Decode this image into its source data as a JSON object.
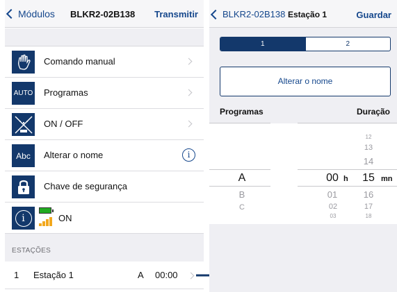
{
  "left": {
    "nav": {
      "back_label": "Módulos",
      "title": "BLKR2-02B138",
      "action_label": "Transmitir"
    },
    "menu": [
      {
        "icon": "hand-icon",
        "label": "Comando manual"
      },
      {
        "icon_text": "AUTO",
        "label": "Programas"
      },
      {
        "icon": "sprinkler-off-icon",
        "label": "ON / OFF"
      },
      {
        "icon_text": "Abc",
        "label": "Alterar o nome",
        "info": "i"
      },
      {
        "icon": "padlock-icon",
        "label": "Chave de segurança"
      },
      {
        "icon": "info-icon",
        "info_glyph": "i",
        "status": "ON"
      }
    ],
    "section_header": "ESTAÇÕES",
    "station": {
      "number": "1",
      "name": "Estação 1",
      "program": "A",
      "time": "00:00"
    }
  },
  "right": {
    "nav": {
      "back_label": "BLKR2-02B138",
      "title": "Estação 1",
      "action_label": "Guardar"
    },
    "segments": [
      "1",
      "2"
    ],
    "selected_segment": "1",
    "rename_button": "Alterar o nome",
    "columns": {
      "programs": "Programas",
      "duration": "Duração"
    },
    "program_picker": {
      "selected": "A",
      "below": [
        "B",
        "C"
      ]
    },
    "hours_picker": {
      "selected": "00",
      "unit": "h",
      "below": [
        "01",
        "02",
        "03"
      ]
    },
    "minutes_picker": {
      "above": [
        "12",
        "13",
        "14"
      ],
      "selected": "15",
      "unit": "mn",
      "below": [
        "16",
        "17",
        "18"
      ]
    }
  },
  "colors": {
    "accent": "#15478c",
    "icon_bg": "#13386b",
    "battery": "#22aa22",
    "signal": "#f2a81e"
  }
}
